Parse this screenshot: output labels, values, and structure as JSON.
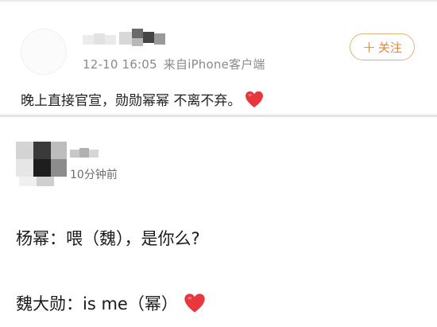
{
  "post1": {
    "timestamp": "12-10 16:05",
    "source": "来自iPhone客户端",
    "follow_label": "关注",
    "follow_plus": "+",
    "text": "晚上直接官宣，勋勋幂幂 不离不弃。"
  },
  "post2": {
    "time_ago": "10分钟前",
    "lines": [
      {
        "text": "杨幂：喂（魏），是你么?"
      },
      {
        "text": "魏大勋：is me（幂）"
      }
    ]
  },
  "colors": {
    "accent": "#d9884a",
    "heart": "#e8383d",
    "meta": "#8a8a8a"
  },
  "icons": {
    "heart": "heart-emoji-icon",
    "plus": "plus-icon"
  }
}
